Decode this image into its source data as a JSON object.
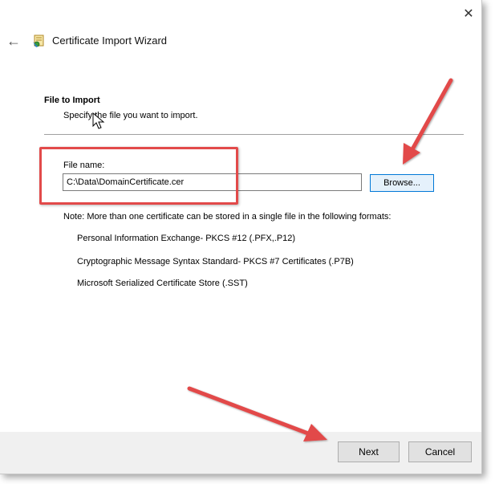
{
  "window": {
    "close_glyph": "✕",
    "back_glyph": "←"
  },
  "header": {
    "title": "Certificate Import Wizard",
    "icon": "certificate-wizard-icon"
  },
  "section": {
    "title": "File to Import",
    "subtitle": "Specify the file you want to import."
  },
  "file": {
    "label": "File name:",
    "value": "C:\\Data\\DomainCertificate.cer",
    "browse_label": "Browse..."
  },
  "note": "Note:  More than one certificate can be stored in a single file in the following formats:",
  "formats": [
    "Personal Information Exchange- PKCS #12 (.PFX,.P12)",
    "Cryptographic Message Syntax Standard- PKCS #7 Certificates (.P7B)",
    "Microsoft Serialized Certificate Store (.SST)"
  ],
  "footer": {
    "next_label": "Next",
    "cancel_label": "Cancel"
  },
  "colors": {
    "annotation_red": "#e24a4a",
    "focus_blue": "#0078d7",
    "footer_bg": "#f0f0f0"
  }
}
